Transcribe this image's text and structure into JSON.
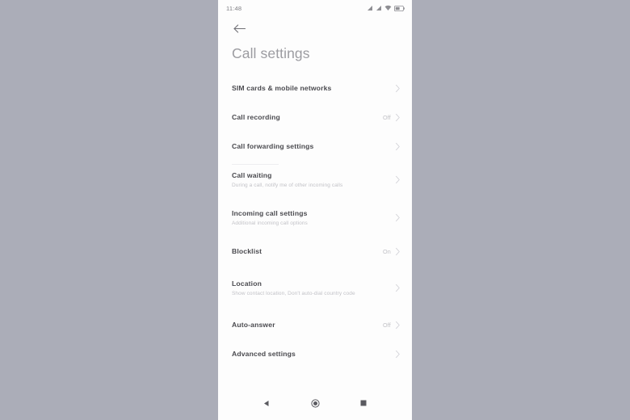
{
  "status_bar": {
    "time": "11:48",
    "icons": [
      "signal-icon",
      "signal-icon",
      "wifi-icon",
      "battery-icon"
    ]
  },
  "top_bar": {
    "back_icon": "back-arrow-icon"
  },
  "header": {
    "title": "Call settings"
  },
  "colors": {
    "page_background": "#abadb8",
    "screen_background": "#fdfdfd",
    "title_text": "#9c9ca1",
    "item_title_text": "#4a4a4f",
    "item_subtitle_text": "#c2c2c7",
    "item_value_text": "#c0c0c5",
    "chevron": "#d2d2d7"
  },
  "settings_items": [
    {
      "title": "SIM cards & mobile networks",
      "subtitle": "",
      "value": "",
      "chevron": "chevron-right-icon"
    },
    {
      "title": "Call recording",
      "subtitle": "",
      "value": "Off",
      "chevron": "chevron-right-icon"
    },
    {
      "title": "Call forwarding settings",
      "subtitle": "",
      "value": "",
      "chevron": "chevron-right-icon"
    },
    {
      "title": "Call waiting",
      "subtitle": "During a call, notify me of other incoming calls",
      "value": "",
      "chevron": "chevron-right-icon"
    },
    {
      "title": "Incoming call settings",
      "subtitle": "Additional incoming call options",
      "value": "",
      "chevron": "chevron-right-icon"
    },
    {
      "title": "Blocklist",
      "subtitle": "",
      "value": "On",
      "chevron": "chevron-right-icon"
    },
    {
      "title": "Location",
      "subtitle": "Show contact location, Don't auto-dial country code",
      "value": "",
      "chevron": "chevron-right-icon"
    },
    {
      "title": "Auto-answer",
      "subtitle": "",
      "value": "Off",
      "chevron": "chevron-right-icon"
    },
    {
      "title": "Advanced settings",
      "subtitle": "",
      "value": "",
      "chevron": "chevron-right-icon"
    }
  ],
  "nav_bar": {
    "back": "nav-back-icon",
    "home": "nav-home-icon",
    "recents": "nav-recents-icon"
  }
}
